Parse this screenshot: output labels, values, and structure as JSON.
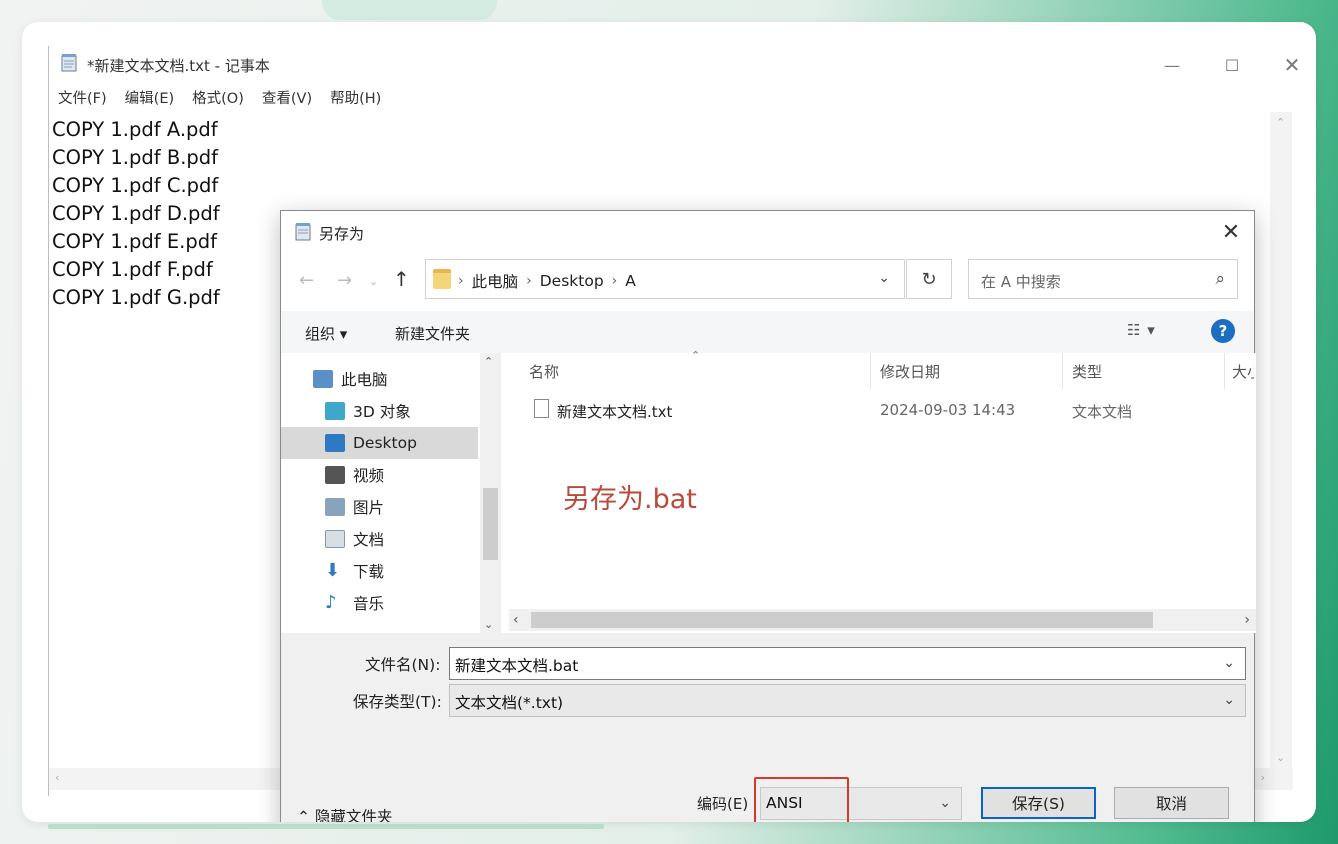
{
  "notepad": {
    "title": "*新建文本文档.txt - 记事本",
    "menu": [
      "文件(F)",
      "编辑(E)",
      "格式(O)",
      "查看(V)",
      "帮助(H)"
    ],
    "lines": [
      "COPY 1.pdf A.pdf",
      "COPY 1.pdf B.pdf",
      "COPY 1.pdf C.pdf",
      "COPY 1.pdf D.pdf",
      "COPY 1.pdf E.pdf",
      "COPY 1.pdf F.pdf",
      "COPY 1.pdf G.pdf"
    ]
  },
  "dialog": {
    "title": "另存为",
    "address": {
      "crumbs": [
        "此电脑",
        "Desktop",
        "A"
      ]
    },
    "search_placeholder": "在 A 中搜索",
    "toolbar": {
      "organize": "组织 ▾",
      "new_folder": "新建文件夹"
    },
    "nav_items": [
      {
        "label": "此电脑",
        "icon": "computer-icon",
        "indent": 0
      },
      {
        "label": "3D 对象",
        "icon": "3d-objects-icon",
        "indent": 1
      },
      {
        "label": "Desktop",
        "icon": "desktop-icon",
        "indent": 1,
        "selected": true
      },
      {
        "label": "视频",
        "icon": "video-icon",
        "indent": 1
      },
      {
        "label": "图片",
        "icon": "pictures-icon",
        "indent": 1
      },
      {
        "label": "文档",
        "icon": "documents-icon",
        "indent": 1
      },
      {
        "label": "下载",
        "icon": "download-icon",
        "indent": 1
      },
      {
        "label": "音乐",
        "icon": "music-icon",
        "indent": 1
      }
    ],
    "columns": [
      "名称",
      "修改日期",
      "类型",
      "大小"
    ],
    "files": [
      {
        "name": "新建文本文档.txt",
        "date": "2024-09-03 14:43",
        "type": "文本文档"
      }
    ],
    "annotation": "另存为.bat",
    "filename_label": "文件名(N):",
    "filename_value": "新建文本文档.bat",
    "filetype_label": "保存类型(T):",
    "filetype_value": "文本文档(*.txt)",
    "hide_folders": "隐藏文件夹",
    "encoding_label": "编码(E)",
    "encoding_value": "ANSI",
    "save_button": "保存(S)",
    "cancel_button": "取消",
    "help_glyph": "?"
  },
  "colors": {
    "annotation": "#b94a3c",
    "highlight_box": "#d63a2e",
    "accent": "#0a64c8"
  }
}
